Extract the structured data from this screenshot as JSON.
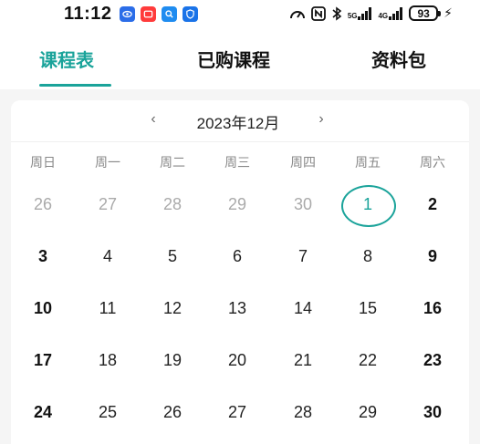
{
  "status_bar": {
    "time": "11:12",
    "app_icons": [
      "eye-app-icon",
      "message-app-icon",
      "search-app-icon",
      "shield-app-icon"
    ],
    "network_labels": [
      "5G",
      "4G"
    ],
    "battery": "93"
  },
  "tabs": [
    {
      "label": "课程表",
      "active": true
    },
    {
      "label": "已购课程",
      "active": false
    },
    {
      "label": "资料包",
      "active": false
    }
  ],
  "calendar": {
    "month_title": "2023年12月",
    "prev_symbol": "‹",
    "next_symbol": "›",
    "weekdays": [
      "周日",
      "周一",
      "周二",
      "周三",
      "周四",
      "周五",
      "周六"
    ],
    "weeks": [
      [
        "26",
        "27",
        "28",
        "29",
        "30",
        "1",
        "2"
      ],
      [
        "3",
        "4",
        "5",
        "6",
        "7",
        "8",
        "9"
      ],
      [
        "10",
        "11",
        "12",
        "13",
        "14",
        "15",
        "16"
      ],
      [
        "17",
        "18",
        "19",
        "20",
        "21",
        "22",
        "23"
      ],
      [
        "24",
        "25",
        "26",
        "27",
        "28",
        "29",
        "30"
      ]
    ],
    "muted_days": [
      "26",
      "27",
      "28",
      "29",
      "30"
    ],
    "selected_day": "1"
  },
  "colors": {
    "accent": "#1aa39a"
  }
}
